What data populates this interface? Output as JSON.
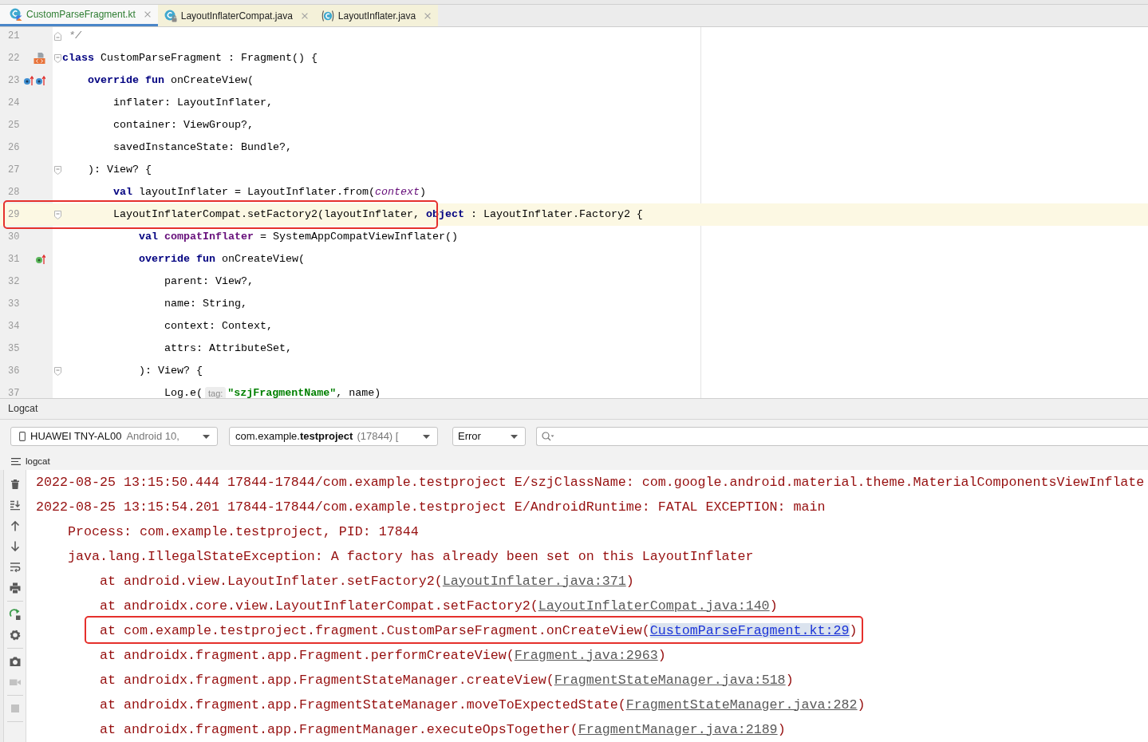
{
  "editor_tabs": [
    {
      "label": "CustomParseFragment.kt",
      "kind": "kotlin",
      "selected": true,
      "color": "#2e7d32"
    },
    {
      "label": "LayoutInflaterCompat.java",
      "kind": "java-locked",
      "selected": false,
      "color": "#222222"
    },
    {
      "label": "LayoutInflater.java",
      "kind": "java",
      "selected": false,
      "color": "#222222"
    }
  ],
  "code_lines": [
    {
      "number": "21",
      "current": false,
      "outlined": false,
      "fold": {
        "kind": "end"
      },
      "tokens": [
        {
          "kind": "comment",
          "text": " */"
        }
      ]
    },
    {
      "number": "22",
      "current": false,
      "outlined": false,
      "fold": {
        "kind": "start"
      },
      "marks": [
        {
          "kind": "related-file"
        }
      ],
      "tokens": [
        {
          "kind": "keyword",
          "text": "class"
        },
        {
          "kind": "plain",
          "text": " CustomParseFragment : Fragment() {"
        }
      ]
    },
    {
      "number": "23",
      "current": false,
      "outlined": false,
      "marks": [
        {
          "kind": "overrides"
        },
        {
          "kind": "overrides"
        }
      ],
      "tokens": [
        {
          "kind": "keyword",
          "text": "    override fun"
        },
        {
          "kind": "plain",
          "text": " onCreateView("
        }
      ]
    },
    {
      "number": "24",
      "current": false,
      "outlined": false,
      "tokens": [
        {
          "kind": "plain",
          "text": "        inflater: LayoutInflater,"
        }
      ]
    },
    {
      "number": "25",
      "current": false,
      "outlined": false,
      "tokens": [
        {
          "kind": "plain",
          "text": "        container: ViewGroup?,"
        }
      ]
    },
    {
      "number": "26",
      "current": false,
      "outlined": false,
      "tokens": [
        {
          "kind": "plain",
          "text": "        savedInstanceState: Bundle?,"
        }
      ]
    },
    {
      "number": "27",
      "current": false,
      "outlined": false,
      "fold": {
        "kind": "start"
      },
      "tokens": [
        {
          "kind": "plain",
          "text": "    ): View? {"
        }
      ]
    },
    {
      "number": "28",
      "current": false,
      "outlined": false,
      "tokens": [
        {
          "kind": "keyword",
          "text": "        val"
        },
        {
          "kind": "plain",
          "text": " layoutInflater = LayoutInflater.from("
        },
        {
          "kind": "param",
          "text": "context"
        },
        {
          "kind": "plain",
          "text": ")"
        }
      ]
    },
    {
      "number": "29",
      "current": true,
      "outlined": true,
      "fold": {
        "kind": "start"
      },
      "tokens": [
        {
          "kind": "plain",
          "text": "        LayoutInflaterCompat.setFactory2(layoutInflater, "
        },
        {
          "kind": "keyword",
          "text": "object"
        },
        {
          "kind": "plain",
          "text": " : LayoutInflater.Factory2 {"
        }
      ]
    },
    {
      "number": "30",
      "current": false,
      "outlined": false,
      "tokens": [
        {
          "kind": "keyword",
          "text": "            val "
        },
        {
          "kind": "field",
          "text": "compatInflater"
        },
        {
          "kind": "plain",
          "text": " = SystemAppCompatViewInflater()"
        }
      ]
    },
    {
      "number": "31",
      "current": false,
      "outlined": false,
      "marks": [
        {
          "kind": "implements"
        }
      ],
      "tokens": [
        {
          "kind": "keyword",
          "text": "            override fun"
        },
        {
          "kind": "plain",
          "text": " onCreateView("
        }
      ]
    },
    {
      "number": "32",
      "current": false,
      "outlined": false,
      "tokens": [
        {
          "kind": "plain",
          "text": "                parent: View?,"
        }
      ]
    },
    {
      "number": "33",
      "current": false,
      "outlined": false,
      "tokens": [
        {
          "kind": "plain",
          "text": "                name: String,"
        }
      ]
    },
    {
      "number": "34",
      "current": false,
      "outlined": false,
      "tokens": [
        {
          "kind": "plain",
          "text": "                context: Context,"
        }
      ]
    },
    {
      "number": "35",
      "current": false,
      "outlined": false,
      "tokens": [
        {
          "kind": "plain",
          "text": "                attrs: AttributeSet,"
        }
      ]
    },
    {
      "number": "36",
      "current": false,
      "outlined": false,
      "fold": {
        "kind": "start"
      },
      "tokens": [
        {
          "kind": "plain",
          "text": "            ): View? {"
        }
      ]
    },
    {
      "number": "37",
      "current": false,
      "outlined": false,
      "tokens": [
        {
          "kind": "plain",
          "text": "                Log.e("
        },
        {
          "kind": "hint",
          "text": "tag:"
        },
        {
          "kind": "string",
          "text": "\"szjFragmentName\""
        },
        {
          "kind": "plain",
          "text": ", name)"
        }
      ]
    }
  ],
  "logcat": {
    "title": "Logcat",
    "device": {
      "name": "HUAWEI TNY-AL00",
      "detail": "Android 10,"
    },
    "process": {
      "name": "com.example.**testproject**",
      "detail": "(17844) ["
    },
    "level": "Error",
    "tab": "logcat",
    "toolbar": [
      {
        "disabled": false
      },
      {
        "disabled": false
      },
      {
        "disabled": false
      },
      {
        "disabled": false
      },
      {
        "disabled": false
      },
      {
        "disabled": false
      },
      {
        "disabled": false
      },
      {
        "disabled": false
      },
      {
        "disabled": false
      },
      {
        "disabled": true
      },
      {
        "disabled": true
      }
    ],
    "entries": [
      {
        "text": "2022-08-25 13:15:50.444 17844-17844/com.example.testproject E/szjClassName: com.google.android.material.theme.MaterialComponentsViewInflate"
      },
      {
        "text": "2022-08-25 13:15:54.201 17844-17844/com.example.testproject E/AndroidRuntime: FATAL EXCEPTION: main",
        "children": [
          {
            "text": "Process: com.example.testproject, PID: 17844"
          },
          {
            "text": "java.lang.IllegalStateException: A factory has already been set on this LayoutInflater",
            "children": [
              {
                "text": "at android.view.LayoutInflater.setFactory2(",
                "link": {
                  "text": "LayoutInflater.java:371",
                  "selected": false
                },
                "after": ")",
                "outlined": false
              },
              {
                "text": "at androidx.core.view.LayoutInflaterCompat.setFactory2(",
                "link": {
                  "text": "LayoutInflaterCompat.java:140",
                  "selected": false
                },
                "after": ")",
                "outlined": false
              },
              {
                "text": "at com.example.testproject.fragment.CustomParseFragment.onCreateView(",
                "link": {
                  "text": "CustomParseFragment.kt:29",
                  "selected": true
                },
                "after": ")",
                "outlined": true
              },
              {
                "text": "at androidx.fragment.app.Fragment.performCreateView(",
                "link": {
                  "text": "Fragment.java:2963",
                  "selected": false
                },
                "after": ")",
                "outlined": false
              },
              {
                "text": "at androidx.fragment.app.FragmentStateManager.createView(",
                "link": {
                  "text": "FragmentStateManager.java:518",
                  "selected": false
                },
                "after": ")",
                "outlined": false
              },
              {
                "text": "at androidx.fragment.app.FragmentStateManager.moveToExpectedState(",
                "link": {
                  "text": "FragmentStateManager.java:282",
                  "selected": false
                },
                "after": ")",
                "outlined": false
              },
              {
                "text": "at androidx.fragment.app.FragmentManager.executeOpsTogether(",
                "link": {
                  "text": "FragmentManager.java:2189",
                  "selected": false
                },
                "after": ")",
                "outlined": false
              }
            ]
          }
        ]
      }
    ]
  }
}
